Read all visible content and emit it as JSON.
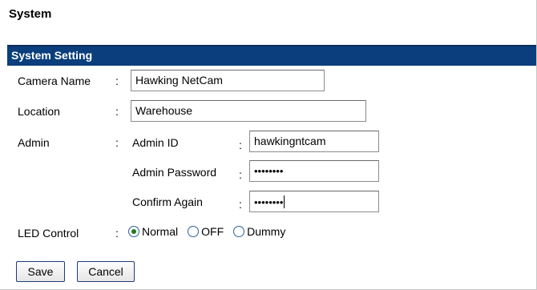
{
  "page": {
    "title": "System"
  },
  "section": {
    "title": "System Setting"
  },
  "fields": {
    "camera_name": {
      "label": "Camera Name",
      "value": "Hawking NetCam"
    },
    "location": {
      "label": "Location",
      "value": "Warehouse"
    },
    "admin": {
      "label": "Admin",
      "admin_id": {
        "label": "Admin ID",
        "value": "hawkingntcam"
      },
      "password": {
        "label": "Admin Password",
        "value": "••••••••"
      },
      "confirm": {
        "label": "Confirm Again",
        "value": "••••••••"
      }
    },
    "led_control": {
      "label": "LED Control",
      "options": [
        "Normal",
        "OFF",
        "Dummy"
      ],
      "selected": "Normal"
    }
  },
  "colon": ":",
  "buttons": {
    "save": "Save",
    "cancel": "Cancel"
  },
  "colors": {
    "section_bar": "#0a3e7c",
    "button_border": "#1c3e72"
  }
}
